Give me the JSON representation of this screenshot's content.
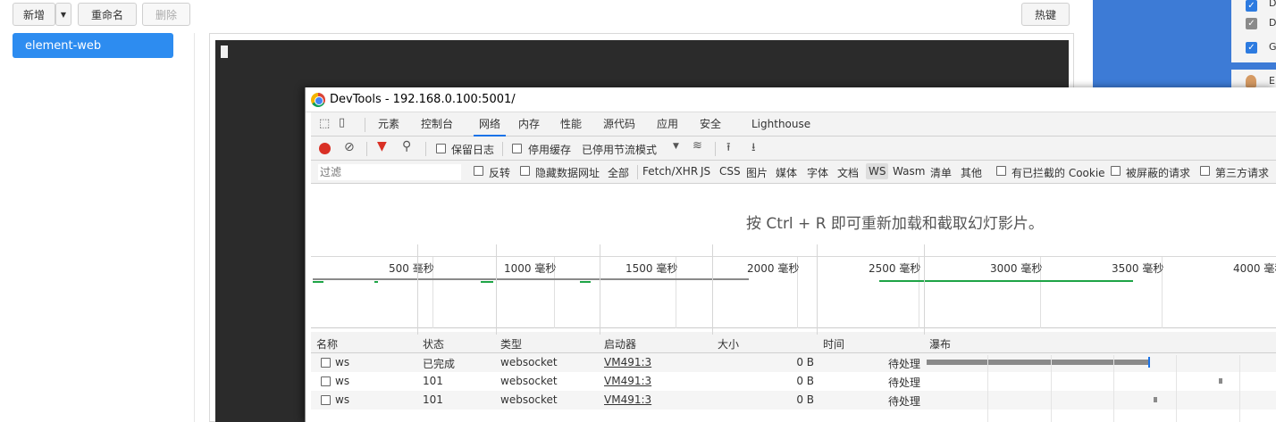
{
  "toolbar": {
    "add_label": "新增",
    "rename_label": "重命名",
    "delete_label": "删除",
    "hotkey_label": "热键"
  },
  "sidebar": {
    "items": [
      {
        "label": "element-web"
      }
    ]
  },
  "right_panel": {
    "items": [
      {
        "label": "D"
      },
      {
        "label": "D"
      },
      {
        "label": "G"
      }
    ],
    "second_label": "E"
  },
  "devtools": {
    "window_title": "DevTools - 192.168.0.100:5001/",
    "tabs": [
      "元素",
      "控制台",
      "网络",
      "内存",
      "性能",
      "源代码",
      "应用",
      "安全",
      "Lighthouse"
    ],
    "active_tab": "网络",
    "toolbar": {
      "preserve_log": "保留日志",
      "disable_cache": "停用缓存",
      "throttling": "已停用节流模式"
    },
    "filter": {
      "placeholder": "过滤",
      "invert": "反转",
      "hide_data_urls": "隐藏数据网址",
      "types": [
        "全部",
        "Fetch/XHR",
        "JS",
        "CSS",
        "图片",
        "媒体",
        "字体",
        "文档",
        "WS",
        "Wasm",
        "清单",
        "其他"
      ],
      "blocked_cookies": "有已拦截的 Cookie",
      "blocked_requests": "被屏蔽的请求",
      "third_party": "第三方请求"
    },
    "hint": "按 Ctrl + R 即可重新加载和截取幻灯影片。",
    "timeline_ticks": [
      "500 毫秒",
      "1000 毫秒",
      "1500 毫秒",
      "2000 毫秒",
      "2500 毫秒",
      "3000 毫秒",
      "3500 毫秒",
      "4000 毫秒"
    ],
    "columns": [
      "名称",
      "状态",
      "类型",
      "启动器",
      "大小",
      "时间",
      "瀑布"
    ],
    "rows": [
      {
        "name": "ws",
        "status": "已完成",
        "type": "websocket",
        "initiator": "VM491:3",
        "size": "0 B",
        "time": "待处理"
      },
      {
        "name": "ws",
        "status": "101",
        "type": "websocket",
        "initiator": "VM491:3",
        "size": "0 B",
        "time": "待处理"
      },
      {
        "name": "ws",
        "status": "101",
        "type": "websocket",
        "initiator": "VM491:3",
        "size": "0 B",
        "time": "待处理"
      }
    ],
    "colors": {
      "record": "#d93025",
      "filter_icon": "#d93025",
      "accent": "#1a73e8",
      "timeline_bar": "#1ea446"
    }
  }
}
